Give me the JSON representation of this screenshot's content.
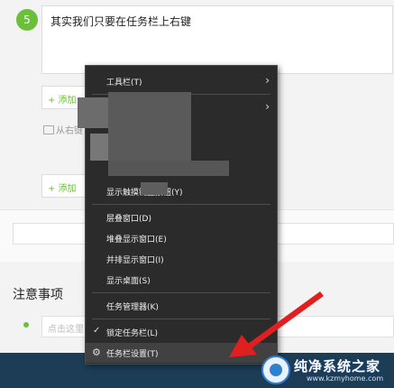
{
  "step": {
    "number": "5",
    "text": "其实我们只要在任务栏上右键"
  },
  "editor": {
    "add_button_label": "+ 添加",
    "image_hint": "从右键",
    "notice_title": "注意事项",
    "notice_placeholder": "点击这里"
  },
  "context_menu": {
    "items": [
      {
        "label": "工具栏(T)",
        "submenu": true
      },
      {
        "label": "",
        "submenu": true
      },
      {
        "label": "显示触摸键盘按钮(Y)"
      },
      {
        "label": "层叠窗口(D)"
      },
      {
        "label": "堆叠显示窗口(E)"
      },
      {
        "label": "并排显示窗口(I)"
      },
      {
        "label": "显示桌面(S)"
      },
      {
        "label": "任务管理器(K)"
      },
      {
        "label": "锁定任务栏(L)",
        "checked": true
      },
      {
        "label": "任务栏设置(T)",
        "icon": "gear-icon",
        "highlighted": true
      }
    ]
  },
  "watermark": {
    "title": "纯净系统之家",
    "url": "www.kzmyhome.com"
  },
  "colors": {
    "accent_green": "#6bbf3a",
    "menu_bg": "#2b2b2b",
    "annotation_red": "#e02020",
    "footer_blue": "#1d3c55"
  }
}
